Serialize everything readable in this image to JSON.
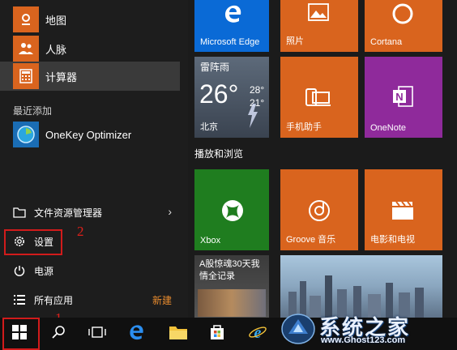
{
  "start_menu": {
    "top_apps": [
      {
        "label": "地图",
        "icon": "map-icon"
      },
      {
        "label": "人脉",
        "icon": "people-icon"
      },
      {
        "label": "计算器",
        "icon": "calculator-icon"
      }
    ],
    "recently_added_header": "最近添加",
    "recent_apps": [
      {
        "label": "OneKey Optimizer",
        "icon": "onekey-optimizer-icon"
      }
    ],
    "system_items": {
      "file_explorer": "文件资源管理器",
      "settings": "设置",
      "power": "电源",
      "all_apps": "所有应用",
      "new_badge": "新建"
    }
  },
  "tiles": {
    "edge": "Microsoft Edge",
    "photos": "照片",
    "cortana": "Cortana",
    "weather": {
      "condition": "雷阵雨",
      "temp": "26°",
      "high": "28°",
      "low": "21°",
      "city": "北京"
    },
    "phone": "手机助手",
    "onenote": "OneNote",
    "group_header": "播放和浏览",
    "xbox": "Xbox",
    "groove": "Groove 音乐",
    "movies": "电影和电视",
    "news": "A股惊魂30天我\n情全记录"
  },
  "annotations": {
    "step1": "1",
    "step2": "2"
  },
  "watermark": {
    "title": "系统之家",
    "url": "www.Ghost123.com"
  },
  "colors": {
    "orange": "#d9641e",
    "blue": "#0a6ad6",
    "purple": "#8f2a9b",
    "green": "#1f7d1f",
    "accent_red": "#d11b1b"
  }
}
